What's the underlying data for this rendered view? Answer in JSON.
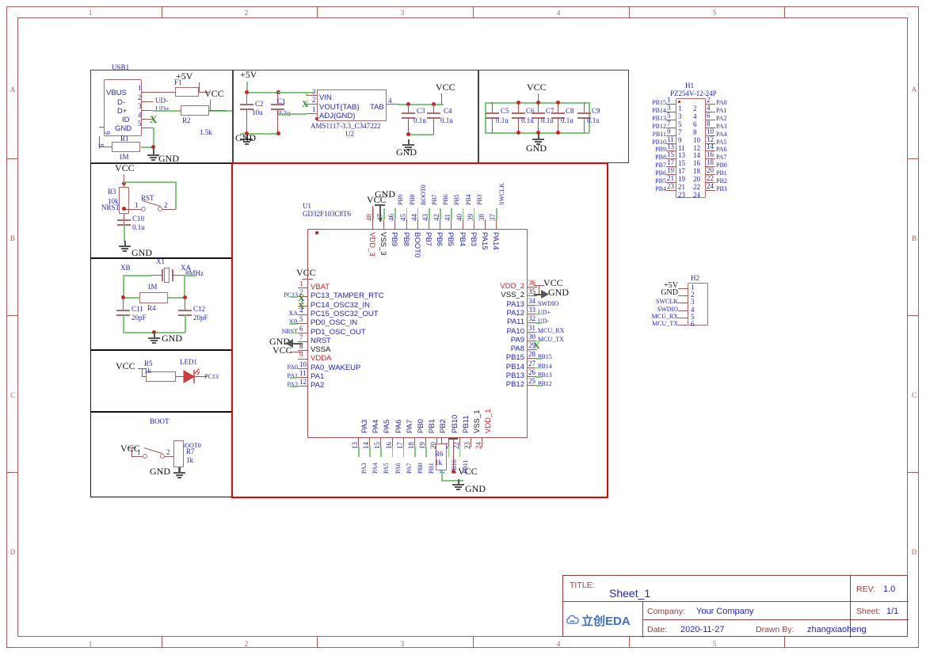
{
  "sheet": {
    "zones_top": [
      "1",
      "2",
      "3",
      "4",
      "5"
    ],
    "zones_side": [
      "A",
      "B",
      "C",
      "D"
    ]
  },
  "title_block": {
    "title_label": "TITLE:",
    "title_value": "Sheet_1",
    "rev_label": "REV:",
    "rev_value": "1.0",
    "company_label": "Company:",
    "company_value": "Your Company",
    "sheet_label": "Sheet:",
    "sheet_value": "1/1",
    "date_label": "Date:",
    "date_value": "2020-11-27",
    "drawn_label": "Drawn By:",
    "drawn_value": "zhangxiaoheng",
    "logo_text": "立创EDA"
  },
  "usb_block": {
    "refdes": "USB1",
    "pins": [
      {
        "num": "1",
        "name": "VBUS"
      },
      {
        "num": "2",
        "name": "D-"
      },
      {
        "num": "3",
        "name": "D+"
      },
      {
        "num": "4",
        "name": "ID"
      },
      {
        "num": "5",
        "name": "GND"
      },
      {
        "num": "6",
        "name": "6"
      }
    ],
    "nets": {
      "dminus": "UD-",
      "dplus": "UD+",
      "p5v": "+5V",
      "vcc": "VCC",
      "gnd": "GND"
    },
    "f1": {
      "refdes": "F1"
    },
    "r1": {
      "refdes": "R1",
      "value": "1M"
    },
    "r2": {
      "refdes": "R2",
      "value": "1.5k"
    },
    "nc_marker": "X"
  },
  "reg_block": {
    "in_net": "+5V",
    "out_net": "VCC",
    "gnd_net": "GND",
    "u2": {
      "refdes": "U2",
      "part": "AMS1117-3.3_C347222",
      "pins": [
        {
          "num": "3",
          "name": "VIN"
        },
        {
          "num": "2",
          "name": "VOUT(TAB)"
        },
        {
          "num": "1",
          "name": "ADJ(GND)"
        },
        {
          "num": "4",
          "name": "TAB"
        }
      ]
    },
    "caps": [
      {
        "refdes": "C2",
        "value": "10u"
      },
      {
        "refdes": "C1",
        "value": "0.1u"
      },
      {
        "refdes": "C3",
        "value": "0.1u"
      },
      {
        "refdes": "C4",
        "value": "0.1u"
      }
    ]
  },
  "decouple_block": {
    "vcc_net": "VCC",
    "gnd_net": "GND",
    "caps": [
      {
        "refdes": "C5",
        "value": "0.1u"
      },
      {
        "refdes": "C6",
        "value": "0.1u"
      },
      {
        "refdes": "C7",
        "value": "0.1u"
      },
      {
        "refdes": "C8",
        "value": "0.1u"
      },
      {
        "refdes": "C9",
        "value": "0.1u"
      }
    ]
  },
  "reset_block": {
    "vcc_net": "VCC",
    "gnd_net": "GND",
    "nrst_net": "NRST",
    "r3": {
      "refdes": "R3",
      "value": "10k"
    },
    "c10": {
      "refdes": "C10",
      "value": "0.1u"
    },
    "sw": {
      "refdes": "RST",
      "pin1": "1",
      "pin2": "2"
    }
  },
  "xtal_block": {
    "refdes": "X1",
    "value": "8MHz",
    "net_left": "XB",
    "net_right": "XA",
    "gnd_net": "GND",
    "r4": {
      "refdes": "R4",
      "value": "1M"
    },
    "c11": {
      "refdes": "C11",
      "value": "20pF"
    },
    "c12": {
      "refdes": "C12",
      "value": "20pF"
    }
  },
  "led_block": {
    "vcc_net": "VCC",
    "r5": {
      "refdes": "R5",
      "value": "1k"
    },
    "led": {
      "refdes": "LED1"
    },
    "net": "PC13"
  },
  "boot_block": {
    "vcc_net": "VCC",
    "gnd_net": "GND",
    "sw": {
      "refdes": "BOOT",
      "pin1": "1",
      "pin2": "2"
    },
    "net": "BOOT0",
    "r7": {
      "refdes": "R7",
      "value": "1k"
    }
  },
  "mcu": {
    "refdes": "U1",
    "part": "GD32F103C8T6",
    "top_pins": [
      {
        "num": "48",
        "name": "VDD_3",
        "net": "VCC",
        "kind": "pwr"
      },
      {
        "num": "47",
        "name": "VSS_3",
        "net": "GND",
        "kind": "gnd"
      },
      {
        "num": "46",
        "name": "PB9",
        "net": "PB9",
        "kind": "io"
      },
      {
        "num": "45",
        "name": "PB8",
        "net": "PB8",
        "kind": "io"
      },
      {
        "num": "44",
        "name": "BOOT0",
        "net": "BOOT0",
        "kind": "io"
      },
      {
        "num": "43",
        "name": "PB7",
        "net": "PB7",
        "kind": "io"
      },
      {
        "num": "42",
        "name": "PB6",
        "net": "PB6",
        "kind": "io"
      },
      {
        "num": "41",
        "name": "PB5",
        "net": "PB5",
        "kind": "io"
      },
      {
        "num": "40",
        "name": "PB4",
        "net": "PB4",
        "kind": "io"
      },
      {
        "num": "39",
        "name": "PB3",
        "net": "PB3",
        "kind": "io"
      },
      {
        "num": "38",
        "name": "PA15",
        "net": "",
        "kind": "io"
      },
      {
        "num": "37",
        "name": "PA14",
        "net": "SWCLK",
        "kind": "io"
      }
    ],
    "left_pins": [
      {
        "num": "1",
        "name": "VBAT",
        "net": "VCC",
        "kind": "pwr"
      },
      {
        "num": "2",
        "name": "PC13_TAMPER_RTC",
        "net": "PC13",
        "kind": "io"
      },
      {
        "num": "3",
        "name": "PC14_OSC32_IN",
        "net": "",
        "kind": "nc"
      },
      {
        "num": "4",
        "name": "PC15_OSC32_OUT",
        "net": "XA",
        "kind": "io"
      },
      {
        "num": "5",
        "name": "PD0_OSC_IN",
        "net": "XB",
        "kind": "io"
      },
      {
        "num": "6",
        "name": "PD1_OSC_OUT",
        "net": "NRST",
        "kind": "io"
      },
      {
        "num": "7",
        "name": "NRST",
        "net": "",
        "kind": "io"
      },
      {
        "num": "8",
        "name": "VSSA",
        "net": "GND",
        "kind": "gnd"
      },
      {
        "num": "9",
        "name": "VDDA",
        "net": "VCC",
        "kind": "pwr"
      },
      {
        "num": "10",
        "name": "PA0_WAKEUP",
        "net": "PA0",
        "kind": "io"
      },
      {
        "num": "11",
        "name": "PA1",
        "net": "PA1",
        "kind": "io"
      },
      {
        "num": "12",
        "name": "PA2",
        "net": "PA2",
        "kind": "io"
      }
    ],
    "right_pins": [
      {
        "num": "36",
        "name": "VDD_2",
        "net": "VCC",
        "kind": "pwr"
      },
      {
        "num": "35",
        "name": "VSS_2",
        "net": "GND",
        "kind": "gnd"
      },
      {
        "num": "34",
        "name": "PA13",
        "net": "SWDIO",
        "kind": "io"
      },
      {
        "num": "33",
        "name": "PA12",
        "net": "UD+",
        "kind": "io"
      },
      {
        "num": "32",
        "name": "PA11",
        "net": "UD-",
        "kind": "io"
      },
      {
        "num": "31",
        "name": "PA10",
        "net": "MCU_RX",
        "kind": "io"
      },
      {
        "num": "30",
        "name": "PA9",
        "net": "MCU_TX",
        "kind": "io"
      },
      {
        "num": "29",
        "name": "PA8",
        "net": "",
        "kind": "nc"
      },
      {
        "num": "28",
        "name": "PB15",
        "net": "PB15",
        "kind": "io"
      },
      {
        "num": "27",
        "name": "PB14",
        "net": "PB14",
        "kind": "io"
      },
      {
        "num": "26",
        "name": "PB13",
        "net": "PB13",
        "kind": "io"
      },
      {
        "num": "25",
        "name": "PB12",
        "net": "PB12",
        "kind": "io"
      }
    ],
    "bottom_pins": [
      {
        "num": "13",
        "name": "PA3",
        "net": "PA3",
        "kind": "io"
      },
      {
        "num": "14",
        "name": "PA4",
        "net": "PA4",
        "kind": "io"
      },
      {
        "num": "15",
        "name": "PA5",
        "net": "PA5",
        "kind": "io"
      },
      {
        "num": "16",
        "name": "PA6",
        "net": "PA6",
        "kind": "io"
      },
      {
        "num": "17",
        "name": "PA7",
        "net": "PA7",
        "kind": "io"
      },
      {
        "num": "18",
        "name": "PB0",
        "net": "PB0",
        "kind": "io"
      },
      {
        "num": "19",
        "name": "PB1",
        "net": "PB1",
        "kind": "io"
      },
      {
        "num": "20",
        "name": "PB2",
        "net": "PB2",
        "kind": "io"
      },
      {
        "num": "21",
        "name": "PB10",
        "net": "PB10",
        "kind": "io"
      },
      {
        "num": "22",
        "name": "PB11",
        "net": "PB11",
        "kind": "io"
      },
      {
        "num": "23",
        "name": "VSS_1",
        "net": "GND",
        "kind": "gnd"
      },
      {
        "num": "24",
        "name": "VDD_1",
        "net": "VCC",
        "kind": "pwr"
      }
    ],
    "r6": {
      "refdes": "R6",
      "value": "1k"
    },
    "vcc_net": "VCC",
    "gnd_net": "GND"
  },
  "h1": {
    "refdes": "H1",
    "part": "PZ254V-12-24P",
    "left_nets": [
      "PB15",
      "PB14",
      "PB13",
      "PB12",
      "PB11",
      "PB10",
      "PB9",
      "PB8",
      "PB7",
      "PB6",
      "PB5",
      "PB4"
    ],
    "left_pins": [
      "1",
      "3",
      "5",
      "7",
      "9",
      "11",
      "13",
      "15",
      "17",
      "19",
      "21",
      "23"
    ],
    "right_nets": [
      "PA0",
      "PA1",
      "PA2",
      "PA3",
      "PA4",
      "PA5",
      "PA6",
      "PA7",
      "PB0",
      "PB1",
      "PB2",
      "PB3"
    ],
    "right_pins": [
      "2",
      "4",
      "6",
      "8",
      "10",
      "12",
      "14",
      "16",
      "18",
      "20",
      "22",
      "24"
    ]
  },
  "h2": {
    "refdes": "H2",
    "nets": [
      "+5V",
      "GND",
      "SWCLK",
      "SWDIO",
      "MCU_RX",
      "MCU_TX"
    ],
    "pins": [
      "1",
      "2",
      "3",
      "4",
      "5",
      "6"
    ]
  },
  "colors": {
    "frame": "#b05a5a",
    "net_label": "#2222cc",
    "power_pin": "#cc2222",
    "wire": "#7ec87e",
    "symbol": "#b06a6a",
    "highlight_box": "#ee0000"
  }
}
